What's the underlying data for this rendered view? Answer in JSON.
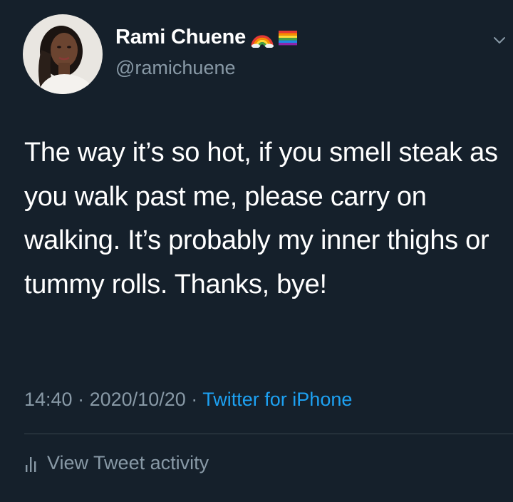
{
  "user": {
    "display_name": "Rami Chuene",
    "handle": "@ramichuene",
    "badges": [
      "rainbow-emoji",
      "rainbow-flag-emoji"
    ]
  },
  "tweet": {
    "text": "The way it’s so hot, if you smell steak as you walk past me, please carry on walking. It’s probably my inner thighs or tummy rolls. Thanks, bye!",
    "time": "14:40",
    "separator": "·",
    "date": "2020/10/20",
    "source": "Twitter for iPhone"
  },
  "actions": {
    "view_activity_label": "View Tweet activity"
  },
  "colors": {
    "background": "#15202b",
    "text": "#ffffff",
    "secondary_text": "#8899a6",
    "link": "#1da1f2",
    "divider": "#38444d"
  },
  "icons": {
    "more": "chevron-down-icon",
    "activity": "bar-chart-icon"
  }
}
